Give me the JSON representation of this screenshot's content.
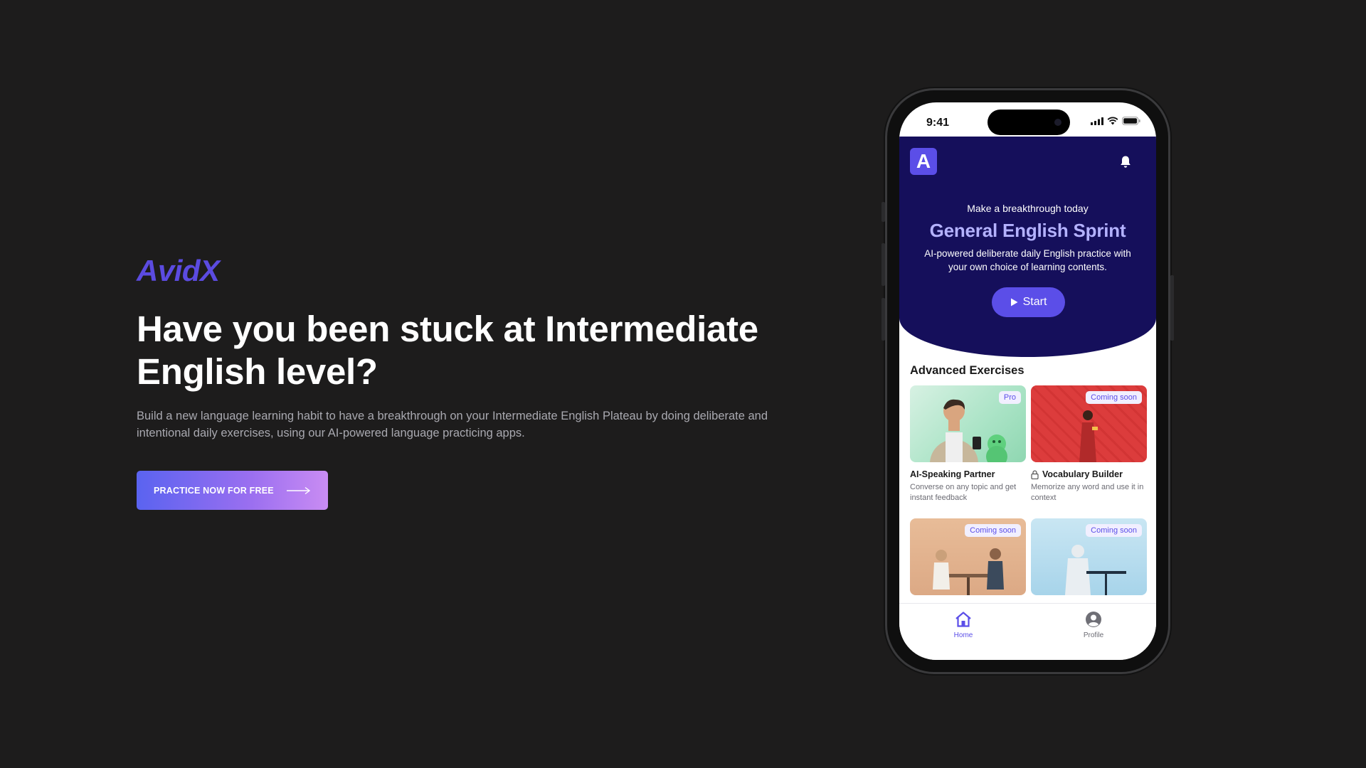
{
  "brand": "AvidX",
  "hero": {
    "headline": "Have you been stuck at Intermediate English level?",
    "subtext": "Build a new language learning habit to have a breakthrough on your Intermediate English Plateau by doing deliberate and intentional daily exercises, using our AI-powered language practicing apps.",
    "cta_label": "PRACTICE NOW FOR FREE"
  },
  "phone": {
    "status_time": "9:41",
    "app_logo_letter": "A",
    "banner": {
      "tagline": "Make a breakthrough today",
      "title": "General English Sprint",
      "description": "AI-powered deliberate daily English practice with your own choice of learning contents.",
      "start_label": "Start"
    },
    "section_title": "Advanced Exercises",
    "cards": [
      {
        "title": "AI-Speaking Partner",
        "description": "Converse on any topic and get instant feedback",
        "tag": "Pro",
        "locked": false
      },
      {
        "title": "Vocabulary Builder",
        "description": "Memorize any word and use it in context",
        "tag": "Coming soon",
        "locked": true
      },
      {
        "title": "",
        "description": "",
        "tag": "Coming soon",
        "locked": true
      },
      {
        "title": "",
        "description": "",
        "tag": "Coming soon",
        "locked": true
      }
    ],
    "tabs": [
      {
        "label": "Home",
        "icon": "home-icon",
        "active": true
      },
      {
        "label": "Profile",
        "icon": "profile-icon",
        "active": false
      }
    ]
  },
  "colors": {
    "background": "#1d1c1c",
    "brand": "#5b4be0",
    "banner": "#150f5b",
    "accent": "#5b4ee8",
    "banner_title": "#b4b2ff"
  }
}
